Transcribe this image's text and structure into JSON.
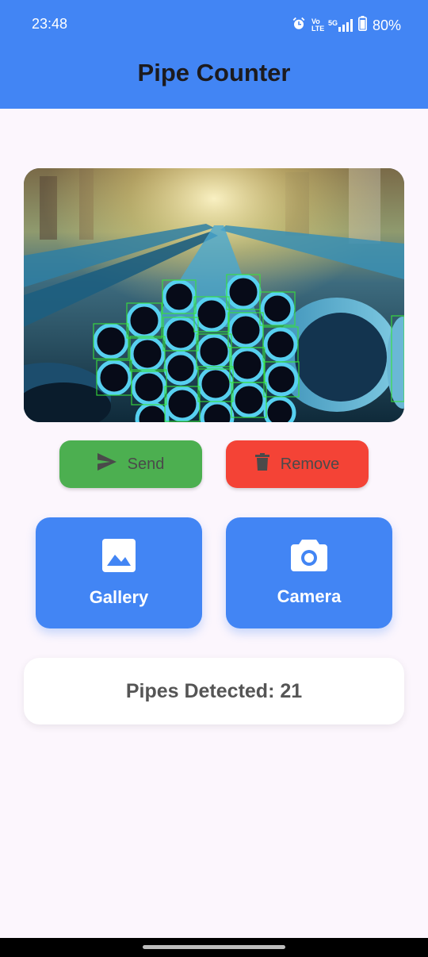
{
  "status_bar": {
    "time": "23:48",
    "icons": [
      "alarm-icon",
      "volte-icon",
      "5g-signal-icon",
      "battery-icon"
    ],
    "volte_label": "Vo LTE",
    "network_label": "5G",
    "battery": "80%"
  },
  "app_bar": {
    "title": "Pipe Counter",
    "color": "#4285f4"
  },
  "image_preview": {
    "content": "photo of stacked blue PVC pipes with green detection boxes"
  },
  "actions": {
    "send_label": "Send",
    "send_icon": "send-icon",
    "send_color": "#4caf50",
    "remove_label": "Remove",
    "remove_icon": "trash-icon",
    "remove_color": "#f44336"
  },
  "sources": {
    "gallery_label": "Gallery",
    "gallery_icon": "image-icon",
    "camera_label": "Camera",
    "camera_icon": "camera-icon"
  },
  "result": {
    "text": "Pipes Detected: 21"
  }
}
